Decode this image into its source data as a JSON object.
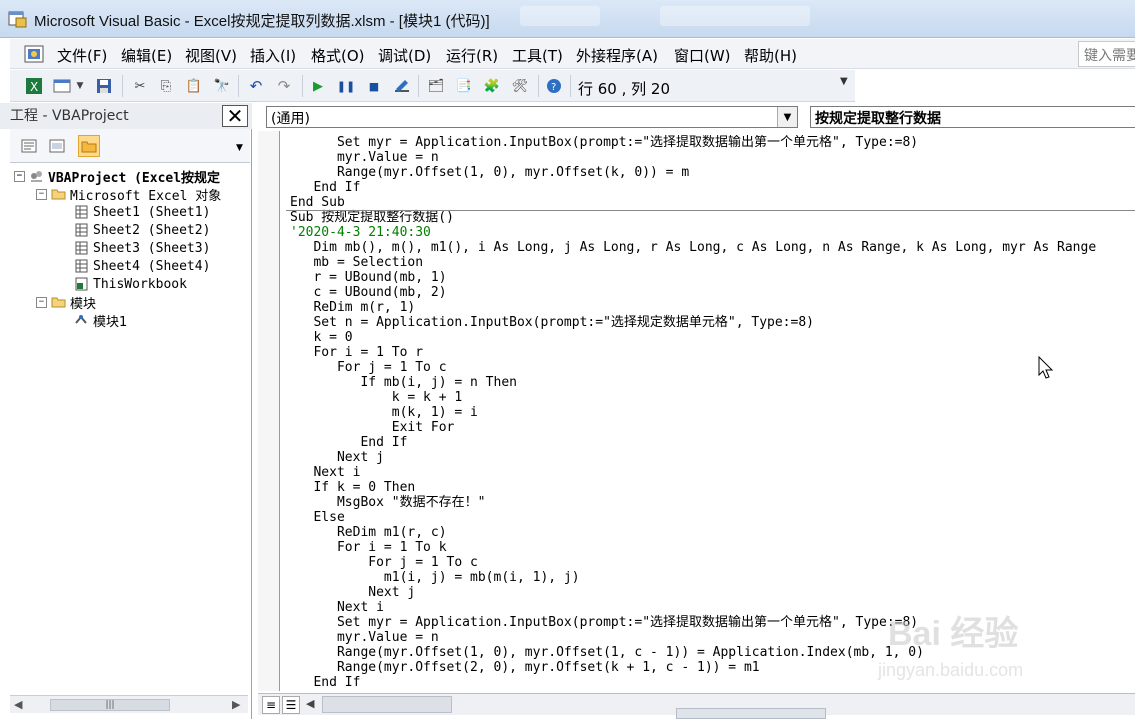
{
  "window": {
    "title": "Microsoft Visual Basic - Excel按规定提取列数据.xlsm - [模块1 (代码)]"
  },
  "menubar": {
    "items": [
      "文件(F)",
      "编辑(E)",
      "视图(V)",
      "插入(I)",
      "格式(O)",
      "调试(D)",
      "运行(R)",
      "工具(T)",
      "外接程序(A)",
      "窗口(W)",
      "帮助(H)"
    ],
    "help_placeholder": "键入需要"
  },
  "toolbar": {
    "position": "行 60 , 列 20"
  },
  "project": {
    "caption": "工程 - VBAProject",
    "close_label": "✕",
    "tree": {
      "root": "VBAProject (Excel按规定",
      "excel_objects": "Microsoft Excel 对象",
      "sheets": [
        "Sheet1 (Sheet1)",
        "Sheet2 (Sheet2)",
        "Sheet3 (Sheet3)",
        "Sheet4 (Sheet4)",
        "ThisWorkbook"
      ],
      "modules": "模块",
      "module1": "模块1"
    }
  },
  "code": {
    "object_combo": "(通用)",
    "procedure_combo": "按规定提取整行数据",
    "lines_prev": [
      "      Set myr = Application.InputBox(prompt:=\"选择提取数据输出第一个单元格\", Type:=8)",
      "      myr.Value = n",
      "      Range(myr.Offset(1, 0), myr.Offset(k, 0)) = m",
      "   End If",
      "End Sub"
    ],
    "lines_main": [
      "Sub 按规定提取整行数据()",
      "'2020-4-3 21:40:30",
      "   Dim mb(), m(), m1(), i As Long, j As Long, r As Long, c As Long, n As Range, k As Long, myr As Range",
      "   mb = Selection",
      "   r = UBound(mb, 1)",
      "   c = UBound(mb, 2)",
      "   ReDim m(r, 1)",
      "   Set n = Application.InputBox(prompt:=\"选择规定数据单元格\", Type:=8)",
      "   k = 0",
      "   For i = 1 To r",
      "      For j = 1 To c",
      "         If mb(i, j) = n Then",
      "             k = k + 1",
      "             m(k, 1) = i",
      "             Exit For",
      "         End If",
      "      Next j",
      "   Next i",
      "   If k = 0 Then",
      "      MsgBox \"数据不存在！\"",
      "   Else",
      "      ReDim m1(r, c)",
      "      For i = 1 To k",
      "          For j = 1 To c",
      "            m1(i, j) = mb(m(i, 1), j)",
      "          Next j",
      "      Next i",
      "      Set myr = Application.InputBox(prompt:=\"选择提取数据输出第一个单元格\", Type:=8)",
      "      myr.Value = n",
      "      Range(myr.Offset(1, 0), myr.Offset(1, c - 1)) = Application.Index(mb, 1, 0)",
      "      Range(myr.Offset(2, 0), myr.Offset(k + 1, c - 1)) = m1",
      "   End If"
    ]
  },
  "watermark": {
    "brand": "Bai 经验",
    "url": "jingyan.baidu.com"
  }
}
